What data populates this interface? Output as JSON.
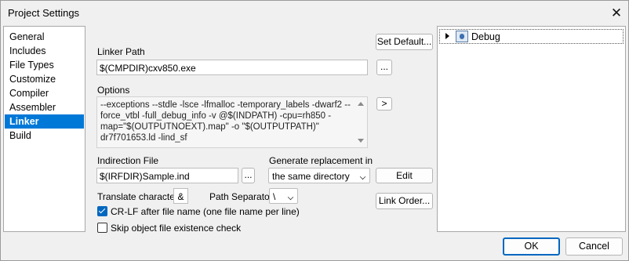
{
  "window": {
    "title": "Project Settings",
    "close_glyph": "✕"
  },
  "nav": {
    "items": [
      {
        "label": "General"
      },
      {
        "label": "Includes"
      },
      {
        "label": "File Types"
      },
      {
        "label": "Customize"
      },
      {
        "label": "Compiler"
      },
      {
        "label": "Assembler"
      },
      {
        "label": "Linker",
        "selected": true
      },
      {
        "label": "Build"
      }
    ]
  },
  "linker": {
    "set_default_label": "Set Default...",
    "linker_path_label": "Linker Path",
    "linker_path_value": "$(CMPDIR)cxv850.exe",
    "browse_label": "...",
    "options_label": "Options",
    "options_value": "--exceptions  --stdle -lsce -lfmalloc -temporary_labels -dwarf2 --\nforce_vtbl -full_debug_info -v @$(INDPATH) -cpu=rh850 -\nmap=\"$(OUTPUTNOEXT).map\" -o \"$(OUTPUTPATH)\"\ndr7f701653.ld -lind_sf",
    "expand_label": ">",
    "indirection_label": "Indirection File",
    "indirection_value": "$(IRFDIR)Sample.ind",
    "indirection_browse_label": "...",
    "replacement_label": "Generate replacement in",
    "replacement_value": "the same directory",
    "edit_label": "Edit",
    "translate_label": "Translate character:",
    "translate_value": "&",
    "path_sep_label": "Path Separator",
    "path_sep_value": "\\",
    "link_order_label": "Link Order...",
    "crlf_label": "CR-LF after file name (one file name per line)",
    "crlf_checked": true,
    "skip_label": "Skip object file existence check",
    "skip_checked": false
  },
  "targets": {
    "items": [
      {
        "label": "Debug",
        "icon": "debug-target-icon"
      }
    ]
  },
  "footer": {
    "ok_label": "OK",
    "cancel_label": "Cancel"
  },
  "colors": {
    "selection": "#0078d7",
    "check_accent": "#0067c0",
    "default_button_border": "#0067c0"
  }
}
